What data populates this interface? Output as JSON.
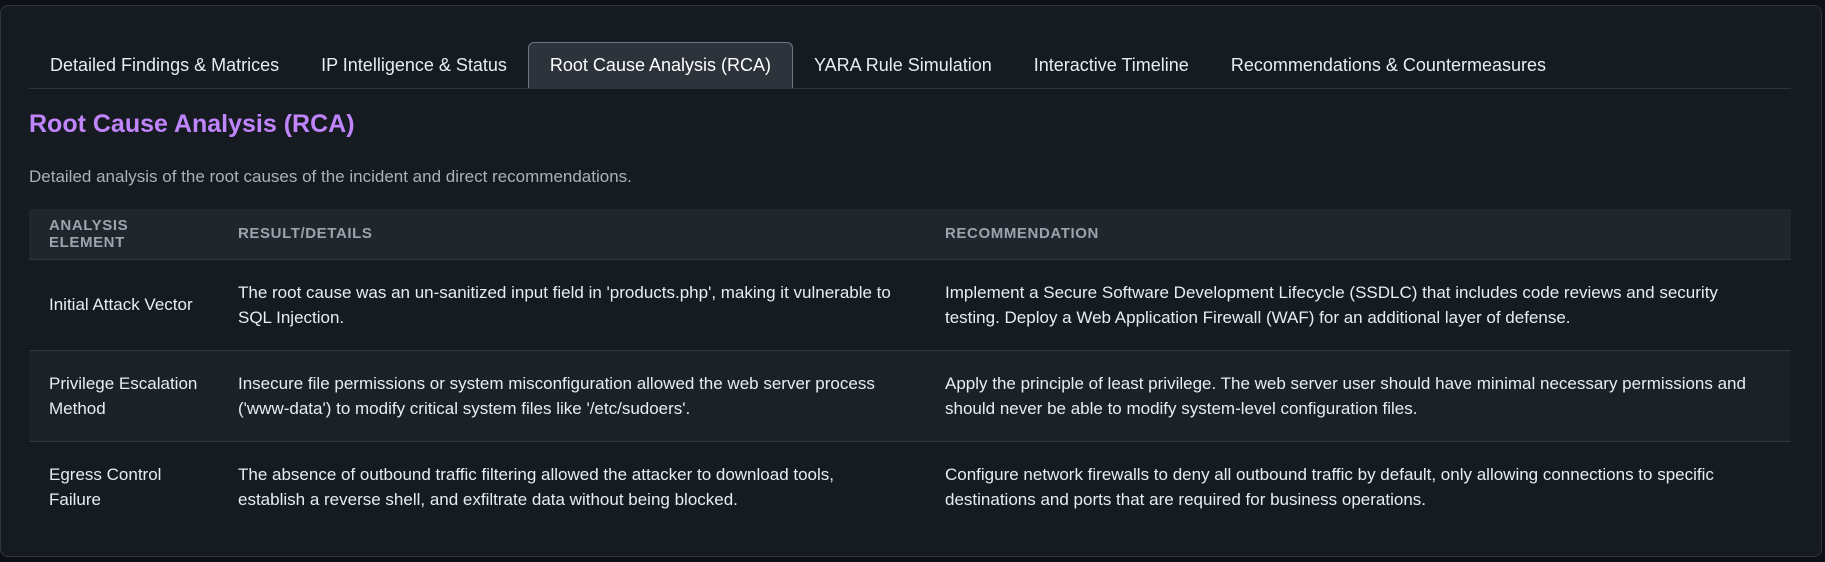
{
  "tabs": [
    {
      "label": "Detailed Findings & Matrices",
      "active": false
    },
    {
      "label": "IP Intelligence & Status",
      "active": false
    },
    {
      "label": "Root Cause Analysis (RCA)",
      "active": true
    },
    {
      "label": "YARA Rule Simulation",
      "active": false
    },
    {
      "label": "Interactive Timeline",
      "active": false
    },
    {
      "label": "Recommendations & Countermeasures",
      "active": false
    }
  ],
  "section": {
    "title": "Root Cause Analysis (RCA)",
    "description": "Detailed analysis of the root causes of the incident and direct recommendations."
  },
  "table": {
    "headers": [
      "ANALYSIS ELEMENT",
      "RESULT/DETAILS",
      "RECOMMENDATION"
    ],
    "rows": [
      {
        "element": "Initial Attack Vector",
        "details": "The root cause was an un-sanitized input field in 'products.php', making it vulnerable to SQL Injection.",
        "recommendation": "Implement a Secure Software Development Lifecycle (SSDLC) that includes code reviews and security testing. Deploy a Web Application Firewall (WAF) for an additional layer of defense."
      },
      {
        "element": "Privilege Escalation Method",
        "details": "Insecure file permissions or system misconfiguration allowed the web server process ('www-data') to modify critical system files like '/etc/sudoers'.",
        "recommendation": "Apply the principle of least privilege. The web server user should have minimal necessary permissions and should never be able to modify system-level configuration files."
      },
      {
        "element": "Egress Control Failure",
        "details": "The absence of outbound traffic filtering allowed the attacker to download tools, establish a reverse shell, and exfiltrate data without being blocked.",
        "recommendation": "Configure network firewalls to deny all outbound traffic by default, only allowing connections to specific destinations and ports that are required for business operations."
      }
    ]
  },
  "colors": {
    "title_accent": "#c084fc",
    "panel_bg": "#161b22",
    "active_tab_bg": "#2d333b"
  }
}
